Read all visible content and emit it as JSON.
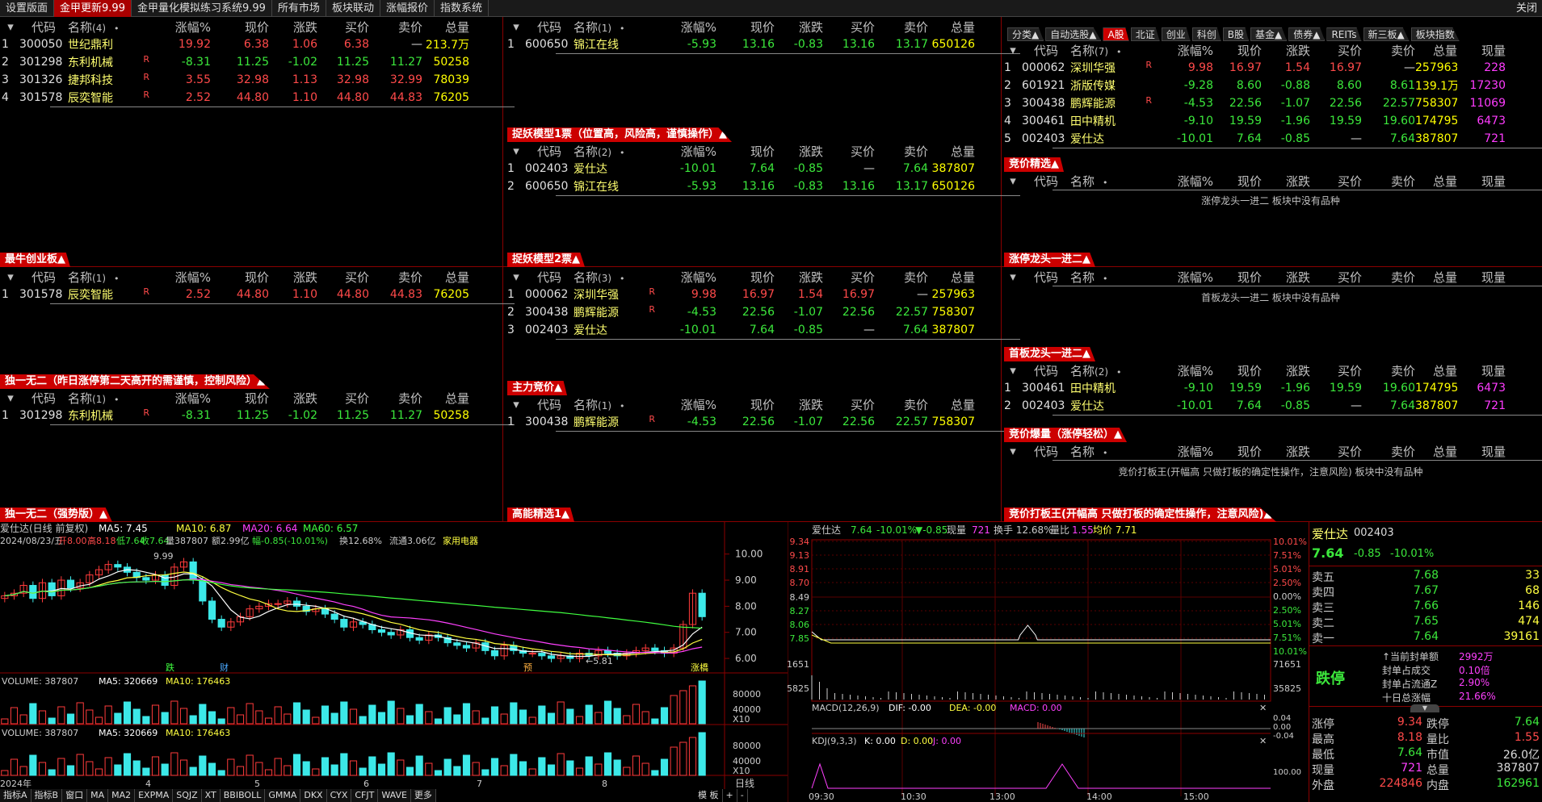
{
  "top_tabs": [
    "设置版面",
    "金甲更新9.99",
    "金甲量化模拟练习系统9.99",
    "所有市场",
    "板块联动",
    "涨幅报价",
    "指数系统"
  ],
  "close_label": "关闭",
  "headers": {
    "code": "代码",
    "name": "名称",
    "pct": "涨幅%",
    "price": "现价",
    "chg": "涨跌",
    "bid": "买价",
    "ask": "卖价",
    "vol": "总量",
    "now": "现量",
    "dot": "•"
  },
  "panels": {
    "p1": {
      "title": "",
      "count": "(4)",
      "rows": [
        [
          "1",
          "300050",
          "世纪鼎利",
          "",
          "19.92",
          "6.38",
          "1.06",
          "6.38",
          "—",
          "213.7万"
        ],
        [
          "2",
          "301298",
          "东利机械",
          "R",
          "-8.31",
          "11.25",
          "-1.02",
          "11.25",
          "11.27",
          "50258"
        ],
        [
          "3",
          "301326",
          "捷邦科技",
          "R",
          "3.55",
          "32.98",
          "1.13",
          "32.98",
          "32.99",
          "78039"
        ],
        [
          "4",
          "301578",
          "辰奕智能",
          "R",
          "2.52",
          "44.80",
          "1.10",
          "44.80",
          "44.83",
          "76205"
        ]
      ]
    },
    "p2": {
      "title": "最牛创业板▲",
      "count": "(1)",
      "rows": [
        [
          "1",
          "301578",
          "辰奕智能",
          "R",
          "2.52",
          "44.80",
          "1.10",
          "44.80",
          "44.83",
          "76205"
        ]
      ]
    },
    "p3": {
      "title": "独一无二（昨日涨停第二天高开的需谨慎，控制风险）▲",
      "count": "(1)",
      "rows": [
        [
          "1",
          "301298",
          "东利机械",
          "R",
          "-8.31",
          "11.25",
          "-1.02",
          "11.25",
          "11.27",
          "50258"
        ]
      ]
    },
    "p3b": {
      "title": "独一无二（强势版）▲"
    },
    "m1": {
      "title": "",
      "count": "(1)",
      "rows": [
        [
          "1",
          "600650",
          "锦江在线",
          "",
          "-5.93",
          "13.16",
          "-0.83",
          "13.16",
          "13.17",
          "650126"
        ]
      ]
    },
    "m2": {
      "title": "捉妖模型1票（位置高，风险高，谨慎操作）▲",
      "count": "(2)",
      "rows": [
        [
          "1",
          "002403",
          "爱仕达",
          "",
          "-10.01",
          "7.64",
          "-0.85",
          "—",
          "7.64",
          "387807"
        ],
        [
          "2",
          "600650",
          "锦江在线",
          "",
          "-5.93",
          "13.16",
          "-0.83",
          "13.16",
          "13.17",
          "650126"
        ]
      ]
    },
    "m3": {
      "title": "捉妖模型2票▲",
      "count": "(3)",
      "rows": [
        [
          "1",
          "000062",
          "深圳华强",
          "R",
          "9.98",
          "16.97",
          "1.54",
          "16.97",
          "—",
          "257963"
        ],
        [
          "2",
          "300438",
          "鹏辉能源",
          "R",
          "-4.53",
          "22.56",
          "-1.07",
          "22.56",
          "22.57",
          "758307"
        ],
        [
          "3",
          "002403",
          "爱仕达",
          "",
          "-10.01",
          "7.64",
          "-0.85",
          "—",
          "7.64",
          "387807"
        ]
      ]
    },
    "m4": {
      "title": "主力竞价▲",
      "count": "(1)",
      "rows": [
        [
          "1",
          "300438",
          "鹏辉能源",
          "R",
          "-4.53",
          "22.56",
          "-1.07",
          "22.56",
          "22.57",
          "758307"
        ]
      ]
    },
    "m4b": {
      "title": "高能精选1▲"
    },
    "r1": {
      "title": "",
      "count": "(7)",
      "rows": [
        [
          "1",
          "000062",
          "深圳华强",
          "R",
          "9.98",
          "16.97",
          "1.54",
          "16.97",
          "—",
          "257963",
          "228"
        ],
        [
          "2",
          "601921",
          "浙版传媒",
          "",
          "-9.28",
          "8.60",
          "-0.88",
          "8.60",
          "8.61",
          "139.1万",
          "17230"
        ],
        [
          "3",
          "300438",
          "鹏辉能源",
          "R",
          "-4.53",
          "22.56",
          "-1.07",
          "22.56",
          "22.57",
          "758307",
          "11069"
        ],
        [
          "4",
          "300461",
          "田中精机",
          "",
          "-9.10",
          "19.59",
          "-1.96",
          "19.59",
          "19.60",
          "174795",
          "6473"
        ],
        [
          "5",
          "002403",
          "爱仕达",
          "",
          "-10.01",
          "7.64",
          "-0.85",
          "—",
          "7.64",
          "387807",
          "721"
        ]
      ]
    },
    "r2": {
      "title": "竞价精选▲",
      "empty": "涨停龙头一进二 板块中没有品种"
    },
    "r3": {
      "title": "涨停龙头一进二▲",
      "empty": "首板龙头一进二 板块中没有品种"
    },
    "r4": {
      "title": "首板龙头一进二▲",
      "count": "(2)",
      "rows": [
        [
          "1",
          "300461",
          "田中精机",
          "",
          "-9.10",
          "19.59",
          "-1.96",
          "19.59",
          "19.60",
          "174795",
          "6473"
        ],
        [
          "2",
          "002403",
          "爱仕达",
          "",
          "-10.01",
          "7.64",
          "-0.85",
          "—",
          "7.64",
          "387807",
          "721"
        ]
      ]
    },
    "r5": {
      "title": "竞价爆量（涨停轻松）▲",
      "empty": "竞价打板王(开幅高 只做打板的确定性操作，注意风险) 板块中没有品种"
    },
    "r5b": {
      "title": "竞价打板王(开幅高 只做打板的确定性操作，注意风险)▲"
    }
  },
  "right_tabs": [
    "分类▲",
    "自动选股▲",
    "A股",
    "北证",
    "创业",
    "科创",
    "B股",
    "基金▲",
    "债券▲",
    "REITs",
    "新三板▲",
    "板块指数"
  ],
  "kline": {
    "title": "爱仕达(日线 前复权)",
    "ma5": "MA5: 7.45",
    "ma10": "MA10: 6.87",
    "ma20": "MA20: 6.64",
    "ma60": "MA60: 6.57",
    "info1": "2024/08/23/五",
    "open": "开8.00",
    "high": "高8.18",
    "low": "低7.64",
    "close": "收7.64",
    "vol": "量387807",
    "amt": "额2.99亿",
    "rng": "幅-0.85(-10.01%)",
    "turn": "换12.68%",
    "float": "流通3.06亿",
    "industry": "家用电器",
    "peak": "9.99",
    "trough": "5.81",
    "yticks": [
      "10.00",
      "9.00",
      "8.00",
      "7.00",
      "6.00"
    ],
    "markers": [
      "跌",
      "财",
      "预",
      "涨橋"
    ],
    "closes": [
      8.4,
      8.5,
      8.8,
      8.3,
      8.9,
      8.4,
      9.0,
      8.7,
      8.9,
      9.2,
      9.4,
      9.6,
      9.5,
      9.3,
      9.1,
      9.0,
      9.2,
      8.8,
      9.5,
      9.7,
      9.0,
      8.2,
      7.5,
      7.2,
      7.4,
      7.6,
      7.9,
      8.0,
      8.1,
      8.1,
      8.2,
      8.0,
      7.8,
      7.9,
      7.7,
      7.5,
      7.2,
      7.4,
      7.3,
      7.1,
      7.0,
      6.9,
      7.1,
      6.8,
      6.7,
      6.9,
      6.8,
      6.6,
      6.5,
      6.4,
      6.6,
      6.3,
      6.1,
      6.5,
      6.3,
      6.2,
      6.2,
      6.1,
      6.0,
      6.1,
      6.0,
      6.2,
      6.1,
      6.3,
      6.2,
      6.1,
      6.2,
      6.3,
      6.4,
      6.3,
      6.2,
      6.4,
      7.3,
      8.5,
      7.6
    ],
    "xlabels": [
      "2024年",
      "4",
      "5",
      "6",
      "7",
      "8"
    ],
    "period": "日线"
  },
  "volume": {
    "label": "VOLUME: 387807",
    "ma5": "MA5: 320669",
    "ma10": "MA10: 176463",
    "yticks": [
      "80000",
      "40000",
      "X10"
    ]
  },
  "volume2": {
    "label": "VOLUME: 387807",
    "ma5": "MA5: 320669",
    "ma10": "MA10: 176463",
    "yticks": [
      "80000",
      "40000",
      "X10"
    ]
  },
  "bottom_tabs": [
    "指标A",
    "指标B",
    "窗口",
    "MA",
    "MA2",
    "EXPMA",
    "SQJZ",
    "XT",
    "BBIBOLL",
    "GMMA",
    "DKX",
    "CYX",
    "CFJT",
    "WAVE",
    "更多"
  ],
  "bottom_right": [
    "模 板",
    "+",
    "-"
  ],
  "intraday": {
    "name": "爱仕达",
    "price": "7.64",
    "pct": "-10.01%",
    "chg": "▼-0.85",
    "now": "现量",
    "nowv": "721",
    "turn": "换手 12.68%",
    "ratio": "量比",
    "ratiov": "1.55",
    "avg": "均价 7.71",
    "yl": [
      "9.34",
      "9.13",
      "8.91",
      "8.70",
      "8.49",
      "8.27",
      "8.06",
      "7.85",
      "71651",
      "35825"
    ],
    "yr": [
      "10.01%",
      "7.51%",
      "5.01%",
      "2.50%",
      "0.00%",
      "2.50%",
      "5.01%",
      "7.51%",
      "10.01%",
      "71651",
      "35825"
    ],
    "macd": "MACD(12,26,9)",
    "dif": "DIF: -0.00",
    "dea": "DEA: -0.00",
    "macdv": "MACD: 0.00",
    "macd_r": [
      "0.04",
      "0.00",
      "-0.04"
    ],
    "kdj": "KDJ(9,3,3)",
    "k": "K: 0.00",
    "d": "D: 0.00",
    "j": "J: 0.00",
    "kdj_r": [
      "100.00"
    ],
    "times": [
      "09:30",
      "10:30",
      "13:00",
      "14:00",
      "15:00"
    ]
  },
  "quote": {
    "name": "爱仕达",
    "code": "002403",
    "price": "7.64",
    "chg": "-0.85",
    "pct": "-10.01%",
    "asks": [
      [
        "卖五",
        "7.68",
        "33"
      ],
      [
        "卖四",
        "7.67",
        "68"
      ],
      [
        "卖三",
        "7.66",
        "146"
      ],
      [
        "卖二",
        "7.65",
        "474"
      ],
      [
        "卖一",
        "7.64",
        "39161"
      ]
    ],
    "status": "跌停",
    "seal": [
      [
        "↑当前封单额",
        "2992万"
      ],
      [
        "封单占成交",
        "0.10倍"
      ],
      [
        "封单占流通Z",
        "2.90%"
      ],
      [
        "十日总涨幅",
        "21.66%"
      ]
    ],
    "stats": [
      [
        "涨停",
        "9.34",
        "跌停",
        "7.64"
      ],
      [
        "最高",
        "8.18",
        "量比",
        "1.55"
      ],
      [
        "最低",
        "7.64",
        "市值",
        "26.0亿"
      ],
      [
        "现量",
        "721",
        "总量",
        "387807"
      ],
      [
        "外盘",
        "224846",
        "内盘",
        "162961"
      ]
    ]
  }
}
